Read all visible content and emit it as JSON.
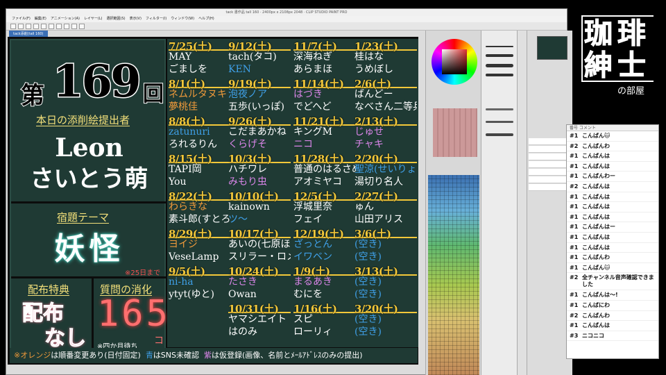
{
  "window": {
    "title": "tack 書作品 tall 160 · 2400px x 2108px 2048 · CLIP STUDIO PAINT PRO",
    "menu": [
      "ファイル(F)",
      "編集(E)",
      "アニメーション(A)",
      "レイヤー(L)",
      "選択範囲(S)",
      "表示(V)",
      "フィルター(I)",
      "ウィンドウ(W)",
      "ヘルプ(H)"
    ],
    "doc_tab": "tack添削(tall 160)"
  },
  "board": {
    "no_prefix": "第",
    "episode": "169",
    "no_suffix": "回",
    "submitter_heading": "本日の添削絵提出者",
    "submitter_name_1": "Leon",
    "submitter_name_2": "さいとう萌",
    "theme_heading": "宿題テーマ",
    "theme": "妖怪",
    "theme_deadline": "※25日まで",
    "bonus_heading": "配布特典",
    "bonus_1": "配布",
    "bonus_2": "なし",
    "questions_heading": "質問の消化",
    "questions_count": "165",
    "questions_unit": "コ",
    "questions_note": "※四か月待ち",
    "legend": {
      "orange": "※オレンジ",
      "orange_text": "は順番変更あり(日付固定)",
      "blue": "青",
      "blue_text": "はSNS未確認",
      "purple": "紫",
      "purple_text": "は仮登録(画像、名前とﾒｰﾙｱﾄﾞﾚｽのみの提出)"
    },
    "colors": {
      "white": "#ffffff",
      "orange": "#f09a3a",
      "blue": "#3fa0e8",
      "purple": "#d985e8",
      "date": "#f3c83a"
    }
  },
  "schedule": [
    [
      {
        "date": "7/25(土)",
        "names": [
          {
            "t": "MAY",
            "c": "white"
          },
          {
            "t": "ごましを",
            "c": "white"
          }
        ]
      },
      {
        "date": "8/1(土)",
        "names": [
          {
            "t": "ネムルタヌキ",
            "c": "orange"
          },
          {
            "t": "夢桃佳",
            "c": "orange"
          }
        ]
      },
      {
        "date": "8/8(土)",
        "names": [
          {
            "t": "zatunuri",
            "c": "blue"
          },
          {
            "t": "ろれるりん",
            "c": "white"
          }
        ]
      },
      {
        "date": "8/15(土)",
        "names": [
          {
            "t": "TAPI岡",
            "c": "white"
          },
          {
            "t": "You",
            "c": "white"
          }
        ]
      },
      {
        "date": "8/22(土)",
        "names": [
          {
            "t": "わらきな",
            "c": "orange"
          },
          {
            "t": "素斗郎(すとろう)",
            "c": "white"
          }
        ]
      },
      {
        "date": "8/29(土)",
        "names": [
          {
            "t": "ヨイジ",
            "c": "orange"
          },
          {
            "t": "VeseLamp",
            "c": "white"
          }
        ]
      },
      {
        "date": "9/5(土)",
        "names": [
          {
            "t": "ni-ha",
            "c": "blue"
          },
          {
            "t": "ytyt(ゆと)",
            "c": "white"
          }
        ]
      }
    ],
    [
      {
        "date": "9/12(土)",
        "names": [
          {
            "t": "tach(タコ)",
            "c": "white"
          },
          {
            "t": "KEN",
            "c": "blue"
          }
        ]
      },
      {
        "date": "9/19(土)",
        "names": [
          {
            "t": "泡夜ノア",
            "c": "blue"
          },
          {
            "t": "五歩(いっぽ)",
            "c": "white"
          }
        ]
      },
      {
        "date": "9/26(土)",
        "names": [
          {
            "t": "こだまあかね",
            "c": "white"
          },
          {
            "t": "くらげそ",
            "c": "purple"
          }
        ]
      },
      {
        "date": "10/3(土)",
        "names": [
          {
            "t": "ハチワレ",
            "c": "white"
          },
          {
            "t": "みもり虫",
            "c": "purple"
          }
        ]
      },
      {
        "date": "10/10(土)",
        "names": [
          {
            "t": "kainown",
            "c": "white"
          },
          {
            "t": "ツ～",
            "c": "blue"
          }
        ]
      },
      {
        "date": "10/17(土)",
        "names": [
          {
            "t": "あいの(七原ほる)",
            "c": "white"
          },
          {
            "t": "スリラー・ロメロ",
            "c": "white"
          }
        ]
      },
      {
        "date": "10/24(土)",
        "names": [
          {
            "t": "たさき",
            "c": "purple"
          },
          {
            "t": "Owan",
            "c": "white"
          }
        ]
      },
      {
        "date": "10/31(土)",
        "names": [
          {
            "t": "ヤマシエイト",
            "c": "white"
          },
          {
            "t": "はのみ",
            "c": "white"
          }
        ]
      }
    ],
    [
      {
        "date": "11/7(土)",
        "names": [
          {
            "t": "深海ねぎ",
            "c": "white"
          },
          {
            "t": "あらまほ",
            "c": "white"
          }
        ]
      },
      {
        "date": "11/14(土)",
        "names": [
          {
            "t": "はづき",
            "c": "purple"
          },
          {
            "t": "でどへど",
            "c": "white"
          }
        ]
      },
      {
        "date": "11/21(土)",
        "names": [
          {
            "t": "キングM",
            "c": "white"
          },
          {
            "t": "ニコ",
            "c": "purple"
          }
        ]
      },
      {
        "date": "11/28(土)",
        "names": [
          {
            "t": "普通のはるさめ",
            "c": "white"
          },
          {
            "t": "アオミヤコ",
            "c": "white"
          }
        ]
      },
      {
        "date": "12/5(土)",
        "names": [
          {
            "t": "浮城里奈",
            "c": "white"
          },
          {
            "t": "フェイ",
            "c": "white"
          }
        ]
      },
      {
        "date": "12/19(土)",
        "names": [
          {
            "t": "ざっとん",
            "c": "blue"
          },
          {
            "t": "イワベン",
            "c": "blue"
          }
        ]
      },
      {
        "date": "1/9(土)",
        "names": [
          {
            "t": "まるあき",
            "c": "purple"
          },
          {
            "t": "むにを",
            "c": "white"
          }
        ]
      },
      {
        "date": "1/16(土)",
        "names": [
          {
            "t": "スピ",
            "c": "white"
          },
          {
            "t": "ローリィ",
            "c": "white"
          }
        ]
      }
    ],
    [
      {
        "date": "1/23(土)",
        "names": [
          {
            "t": "桂はな",
            "c": "white"
          },
          {
            "t": "うめぼし",
            "c": "white"
          }
        ]
      },
      {
        "date": "2/6(土)",
        "names": [
          {
            "t": "ばんどー",
            "c": "white"
          },
          {
            "t": "なべさん二等兵",
            "c": "white"
          }
        ]
      },
      {
        "date": "2/13(土)",
        "names": [
          {
            "t": "じゅせ",
            "c": "purple"
          },
          {
            "t": "チャキ",
            "c": "purple"
          }
        ]
      },
      {
        "date": "2/20(土)",
        "names": [
          {
            "t": "聖涼(せいりょう)",
            "c": "blue"
          },
          {
            "t": "湯切り名人",
            "c": "white"
          }
        ]
      },
      {
        "date": "2/27(土)",
        "names": [
          {
            "t": "ゅん",
            "c": "white"
          },
          {
            "t": "山田アリス",
            "c": "white"
          }
        ]
      },
      {
        "date": "3/6(土)",
        "names": [
          {
            "t": "(空き)",
            "c": "blue"
          },
          {
            "t": "(空き)",
            "c": "blue"
          }
        ]
      },
      {
        "date": "3/13(土)",
        "names": [
          {
            "t": "(空き)",
            "c": "blue"
          },
          {
            "t": "(空き)",
            "c": "blue"
          }
        ]
      },
      {
        "date": "3/20(土)",
        "names": [
          {
            "t": "(空き)",
            "c": "blue"
          },
          {
            "t": "(空き)",
            "c": "blue"
          }
        ]
      }
    ]
  ],
  "panels": {
    "color_wheel_tab": "カラーサークル",
    "brush_tab": "エアブラシ",
    "palette_tab": "カラーセット",
    "layer_tab": "レイヤー"
  },
  "logo": {
    "c1": "珈",
    "c2": "琲",
    "c3": "紳",
    "c4": "士",
    "sub": "の部屋"
  },
  "chat": {
    "header": "番号  コメント",
    "messages": [
      {
        "n": "#1",
        "t": "こんばん🐱"
      },
      {
        "n": "#2",
        "t": "こんばんわ"
      },
      {
        "n": "#1",
        "t": "こんばんは"
      },
      {
        "n": "#1",
        "t": "こんばんは"
      },
      {
        "n": "#1",
        "t": "こんばんわー"
      },
      {
        "n": "#2",
        "t": "こんばんは"
      },
      {
        "n": "#1",
        "t": "こんばんは"
      },
      {
        "n": "#1",
        "t": "こんばんは"
      },
      {
        "n": "#1",
        "t": "こんばんは"
      },
      {
        "n": "#1",
        "t": "こんばんはー"
      },
      {
        "n": "#1",
        "t": "こんばんは"
      },
      {
        "n": "#1",
        "t": "こんばんは"
      },
      {
        "n": "#1",
        "t": "こんばんわ"
      },
      {
        "n": "#1",
        "t": "こんばん🐱"
      },
      {
        "n": "#2",
        "t": "全チャンネル音声確認できました",
        "wrap": true
      },
      {
        "n": "#1",
        "t": "こんばんは～!"
      },
      {
        "n": "#1",
        "t": "こんばにわ"
      },
      {
        "n": "#2",
        "t": "こんばんわ"
      },
      {
        "n": "#1",
        "t": "こんばんは"
      },
      {
        "n": "#3",
        "t": "ニコニコ"
      }
    ]
  }
}
